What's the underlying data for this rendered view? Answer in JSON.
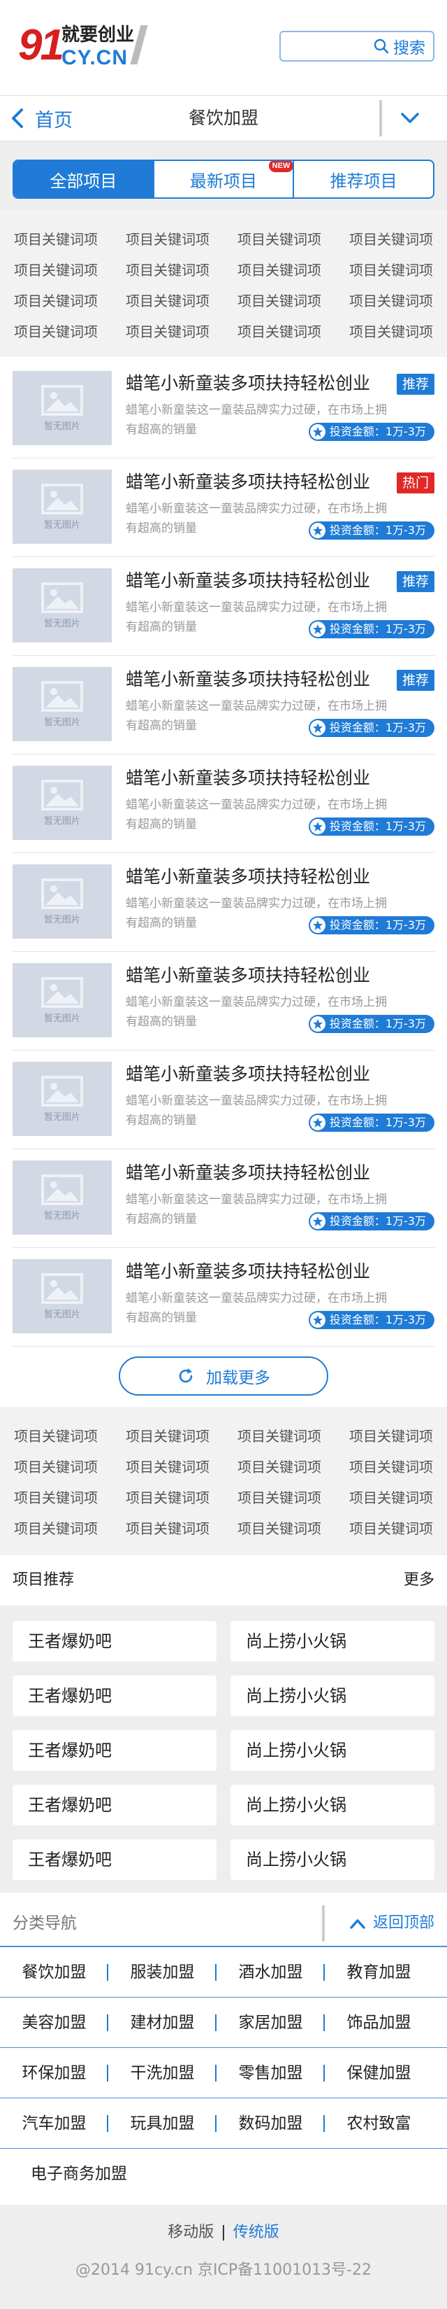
{
  "header": {
    "logo_num": "91",
    "logo_top": "就要创业",
    "logo_bottom": "CY.CN",
    "search_placeholder": "",
    "search_label": "搜索"
  },
  "nav": {
    "back_label": "首页",
    "title": "餐饮加盟"
  },
  "tabs": [
    {
      "label": "全部项目",
      "active": true
    },
    {
      "label": "最新项目",
      "badge": "NEW"
    },
    {
      "label": "推荐项目"
    }
  ],
  "keywords_top": [
    [
      "项目关键词项",
      "项目关键词项",
      "项目关键词项",
      "项目关键词项"
    ],
    [
      "项目关键词项",
      "项目关键词项",
      "项目关键词项",
      "项目关键词项"
    ],
    [
      "项目关键词项",
      "项目关键词项",
      "项目关键词项",
      "项目关键词项"
    ],
    [
      "项目关键词项",
      "项目关键词项",
      "项目关键词项",
      "项目关键词项"
    ]
  ],
  "items": [
    {
      "thumb": "暂无图片",
      "title": "蜡笔小新童装多项扶持轻松创业",
      "desc": "蜡笔小新童装这一童装品牌实力过硬，在市场上拥有超高的销量",
      "tag": "推荐",
      "tag_color": "#1f7bd6",
      "invest": "投资金额：1万-3万"
    },
    {
      "thumb": "暂无图片",
      "title": "蜡笔小新童装多项扶持轻松创业",
      "desc": "蜡笔小新童装这一童装品牌实力过硬，在市场上拥有超高的销量",
      "tag": "热门",
      "tag_color": "#e02828",
      "invest": "投资金额：1万-3万"
    },
    {
      "thumb": "暂无图片",
      "title": "蜡笔小新童装多项扶持轻松创业",
      "desc": "蜡笔小新童装这一童装品牌实力过硬，在市场上拥有超高的销量",
      "tag": "推荐",
      "tag_color": "#1f7bd6",
      "invest": "投资金额：1万-3万"
    },
    {
      "thumb": "暂无图片",
      "title": "蜡笔小新童装多项扶持轻松创业",
      "desc": "蜡笔小新童装这一童装品牌实力过硬，在市场上拥有超高的销量",
      "tag": "推荐",
      "tag_color": "#1f7bd6",
      "invest": "投资金额：1万-3万"
    },
    {
      "thumb": "暂无图片",
      "title": "蜡笔小新童装多项扶持轻松创业",
      "desc": "蜡笔小新童装这一童装品牌实力过硬，在市场上拥有超高的销量",
      "tag": "",
      "invest": "投资金额：1万-3万"
    },
    {
      "thumb": "暂无图片",
      "title": "蜡笔小新童装多项扶持轻松创业",
      "desc": "蜡笔小新童装这一童装品牌实力过硬，在市场上拥有超高的销量",
      "tag": "",
      "invest": "投资金额：1万-3万"
    },
    {
      "thumb": "暂无图片",
      "title": "蜡笔小新童装多项扶持轻松创业",
      "desc": "蜡笔小新童装这一童装品牌实力过硬，在市场上拥有超高的销量",
      "tag": "",
      "invest": "投资金额：1万-3万"
    },
    {
      "thumb": "暂无图片",
      "title": "蜡笔小新童装多项扶持轻松创业",
      "desc": "蜡笔小新童装这一童装品牌实力过硬，在市场上拥有超高的销量",
      "tag": "",
      "invest": "投资金额：1万-3万"
    },
    {
      "thumb": "暂无图片",
      "title": "蜡笔小新童装多项扶持轻松创业",
      "desc": "蜡笔小新童装这一童装品牌实力过硬，在市场上拥有超高的销量",
      "tag": "",
      "invest": "投资金额：1万-3万"
    },
    {
      "thumb": "暂无图片",
      "title": "蜡笔小新童装多项扶持轻松创业",
      "desc": "蜡笔小新童装这一童装品牌实力过硬，在市场上拥有超高的销量",
      "tag": "",
      "invest": "投资金额：1万-3万"
    }
  ],
  "load_more": "加载更多",
  "keywords_bottom": [
    [
      "项目关键词项",
      "项目关键词项",
      "项目关键词项",
      "项目关键词项"
    ],
    [
      "项目关键词项",
      "项目关键词项",
      "项目关键词项",
      "项目关键词项"
    ],
    [
      "项目关键词项",
      "项目关键词项",
      "项目关键词项",
      "项目关键词项"
    ],
    [
      "项目关键词项",
      "项目关键词项",
      "项目关键词项",
      "项目关键词项"
    ]
  ],
  "recommend": {
    "title": "项目推荐",
    "more": "更多",
    "items": [
      [
        "王者爆奶吧",
        "尚上捞小火锅"
      ],
      [
        "王者爆奶吧",
        "尚上捞小火锅"
      ],
      [
        "王者爆奶吧",
        "尚上捞小火锅"
      ],
      [
        "王者爆奶吧",
        "尚上捞小火锅"
      ],
      [
        "王者爆奶吧",
        "尚上捞小火锅"
      ]
    ]
  },
  "categories": {
    "title": "分类导航",
    "back_top": "返回顶部",
    "rows": [
      [
        "餐饮加盟",
        "服装加盟",
        "酒水加盟",
        "教育加盟"
      ],
      [
        "美容加盟",
        "建材加盟",
        "家居加盟",
        "饰品加盟"
      ],
      [
        "环保加盟",
        "干洗加盟",
        "零售加盟",
        "保健加盟"
      ],
      [
        "汽车加盟",
        "玩具加盟",
        "数码加盟",
        "农村致富"
      ],
      [
        "电子商务加盟"
      ]
    ]
  },
  "footer": {
    "mobile": "移动版",
    "separator": "|",
    "desktop": "传统版",
    "copyright": "@2014 91cy.cn 京ICP备11001013号-22"
  },
  "colors": {
    "brand_blue": "#1f7bd6",
    "hot_red": "#e02828"
  }
}
